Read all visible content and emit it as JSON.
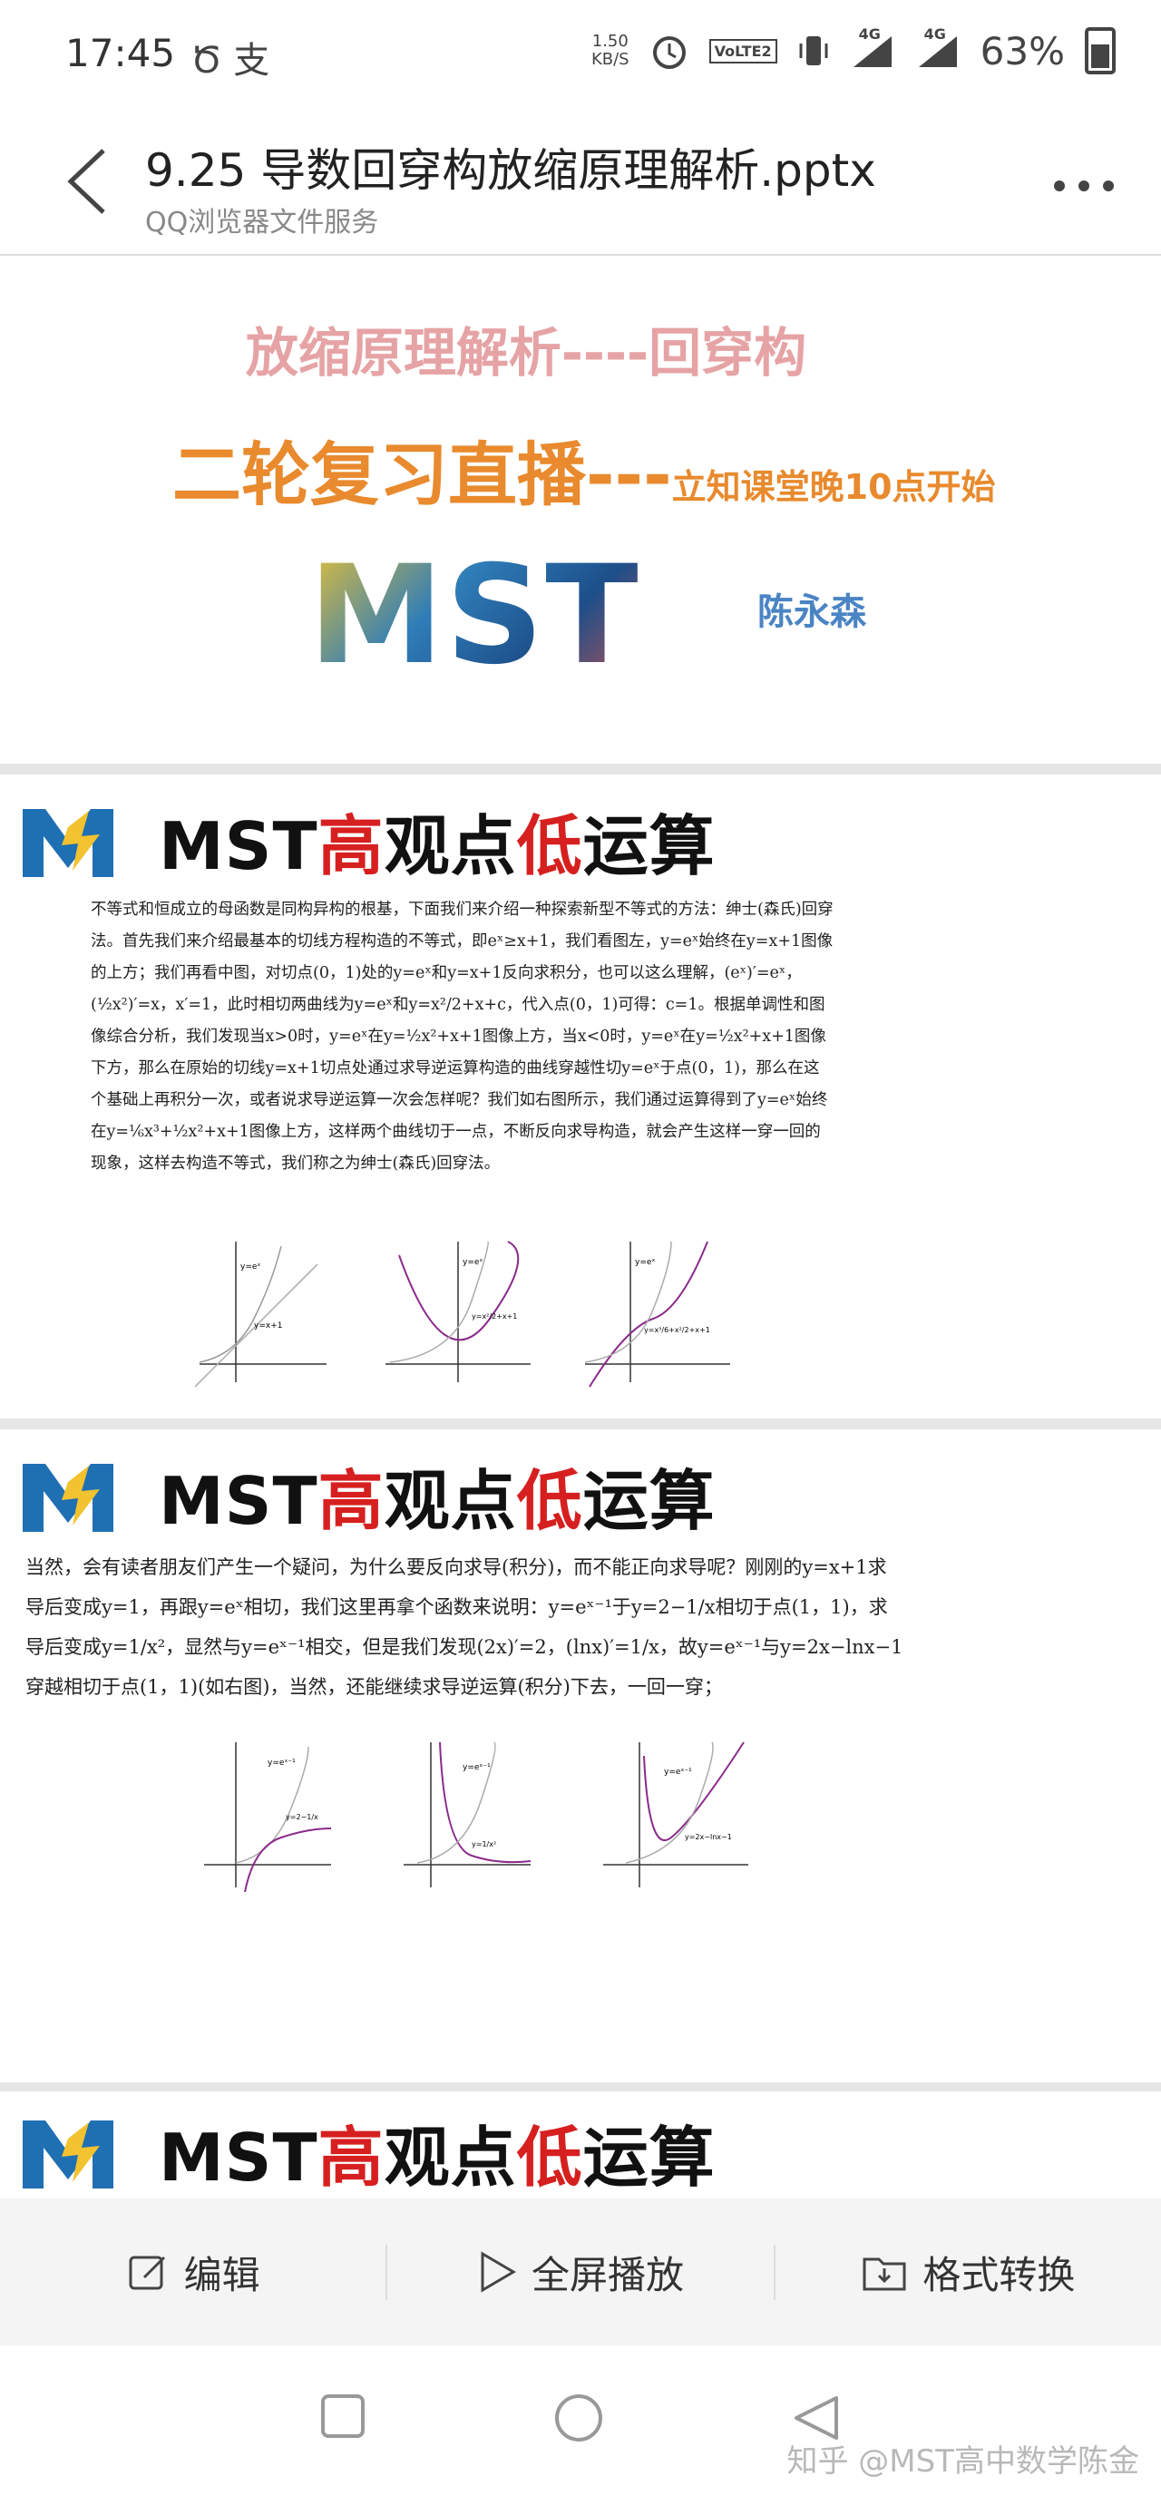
{
  "status": {
    "time": "17:45",
    "left_icons": "Ծ 支",
    "speed_value": "1.50",
    "speed_unit": "KB/S",
    "volte": "VoLTE2",
    "net1": "4G",
    "net2": "4G",
    "battery": "63%"
  },
  "header": {
    "title": "9.25 导数回穿构放缩原理解析.pptx",
    "subtitle": "QQ浏览器文件服务"
  },
  "slide1": {
    "title": "放缩原理解析----回穿构",
    "subtitle_main": "二轮复习直播---",
    "subtitle_small": "立知课堂晚10点开始",
    "logo": "MST",
    "author": "陈永森"
  },
  "brand": {
    "prefix": "MST",
    "gao": "高",
    "mid": "观点",
    "di": "低",
    "suffix": "运算"
  },
  "slide2": {
    "paragraph": "不等式和恒成立的母函数是同构异构的根基，下面我们来介绍一种探索新型不等式的方法：绅士(森氏)回穿法。首先我们来介绍最基本的切线方程构造的不等式，即eˣ≥x+1，我们看图左，y=eˣ始终在y=x+1图像的上方；我们再看中图，对切点(0，1)处的y=eˣ和y=x+1反向求积分，也可以这么理解，(eˣ)′=eˣ，(½x²)′=x，x′=1，此时相切两曲线为y=eˣ和y=x²/2+x+c，代入点(0，1)可得：c=1。根据单调性和图像综合分析，我们发现当x>0时，y=eˣ在y=½x²+x+1图像上方，当x<0时，y=eˣ在y=½x²+x+1图像下方，那么在原始的切线y=x+1切点处通过求导逆运算构造的曲线穿越性切y=eˣ于点(0，1)，那么在这个基础上再积分一次，或者说求导逆运算一次会怎样呢？我们如右图所示，我们通过运算得到了y=eˣ始终在y=⅙x³+½x²+x+1图像上方，这样两个曲线切于一点，不断反向求导构造，就会产生这样一穿一回的现象，这样去构造不等式，我们称之为绅士(森氏)回穿法。",
    "graph_labels": [
      "y=eˣ",
      "y=x+1",
      "y=x²/2+x+1",
      "y=x³/6+x²/2+x+1"
    ]
  },
  "slide3": {
    "paragraph": "当然，会有读者朋友们产生一个疑问，为什么要反向求导(积分)，而不能正向求导呢？刚刚的y=x+1求导后变成y=1，再跟y=eˣ相切，我们这里再拿个函数来说明：y=eˣ⁻¹于y=2−1/x相切于点(1，1)，求导后变成y=1/x²，显然与y=eˣ⁻¹相交，但是我们发现(2x)′=2，(lnx)′=1/x，故y=eˣ⁻¹与y=2x−lnx−1穿越相切于点(1，1)(如右图)，当然，还能继续求导逆运算(积分)下去，一回一穿；",
    "graph_labels": [
      "y=eˣ⁻¹",
      "y=2−1/x",
      "y=1/x²",
      "y=2x−lnx−1"
    ]
  },
  "toolbar": {
    "edit": "编辑",
    "play": "全屏播放",
    "convert": "格式转换"
  },
  "watermark": "知乎 @MST高中数学陈金",
  "colors": {
    "accent_red": "#d62020",
    "orange": "#e88a2d",
    "pink": "#e6a3a5",
    "blue": "#4a84c4"
  }
}
